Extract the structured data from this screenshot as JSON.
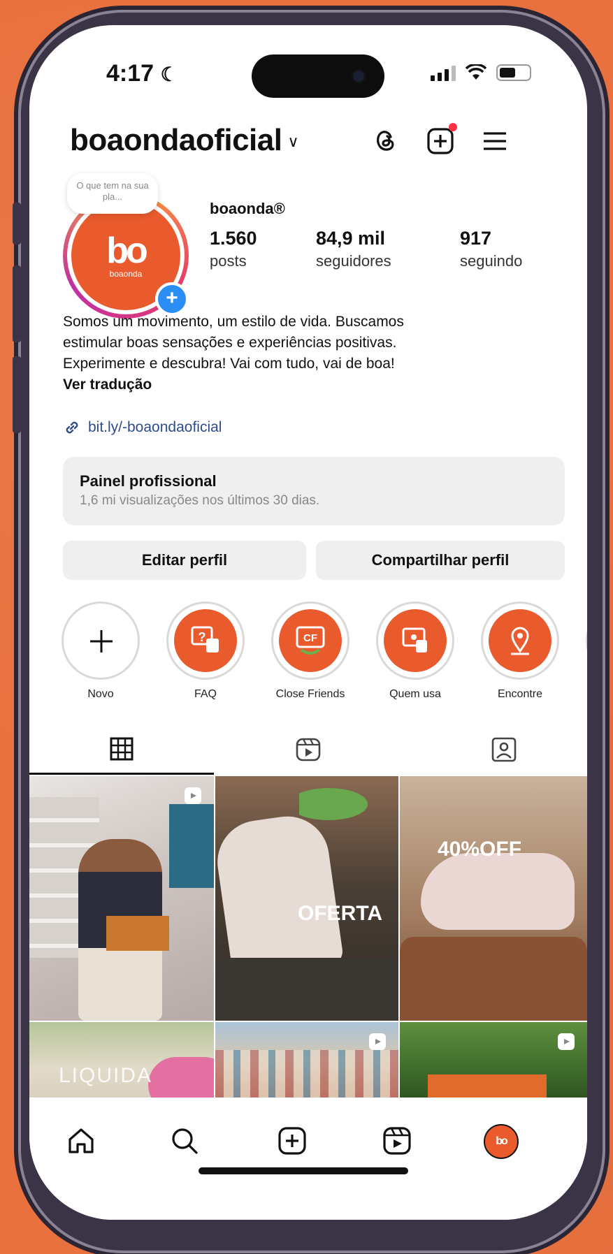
{
  "status": {
    "time": "4:17"
  },
  "header": {
    "username": "boaondaoficial"
  },
  "profile": {
    "note": "O que tem na sua pla...",
    "avatar_text": "bo",
    "avatar_sub": "boaonda",
    "display_name": "boaonda®",
    "stats": [
      {
        "value": "1.560",
        "label": "posts"
      },
      {
        "value": "84,9 mil",
        "label": "seguidores"
      },
      {
        "value": "917",
        "label": "seguindo"
      }
    ],
    "bio": [
      "Somos um movimento, um estilo de vida. Buscamos",
      "estimular boas sensações e experiências positivas.",
      "Experimente e descubra! Vai com tudo, vai de boa!"
    ],
    "see_translation": "Ver tradução",
    "link": "bit.ly/-boaondaoficial"
  },
  "dashboard": {
    "title": "Painel profissional",
    "subtitle": "1,6 mi visualizações nos últimos 30 dias."
  },
  "buttons": {
    "edit": "Editar perfil",
    "share": "Compartilhar perfil"
  },
  "highlights": [
    {
      "label": "Novo",
      "icon": "plus-icon"
    },
    {
      "label": "FAQ",
      "icon": "question-chat-icon"
    },
    {
      "label": "Close Friends",
      "icon": "close-friends-icon"
    },
    {
      "label": "Quem usa",
      "icon": "chat-user-icon"
    },
    {
      "label": "Encontre",
      "icon": "map-pin-icon"
    }
  ],
  "posts": [
    {
      "overlay": ""
    },
    {
      "overlay": "OFERTA"
    },
    {
      "overlay": "40%OFF"
    },
    {
      "overlay": "LIQUIDA"
    },
    {
      "overlay": ""
    },
    {
      "overlay": ""
    }
  ],
  "colors": {
    "brand": "#E95A2C",
    "background": "#E8713F",
    "link": "#2f4c88",
    "notification": "#ff3040"
  }
}
